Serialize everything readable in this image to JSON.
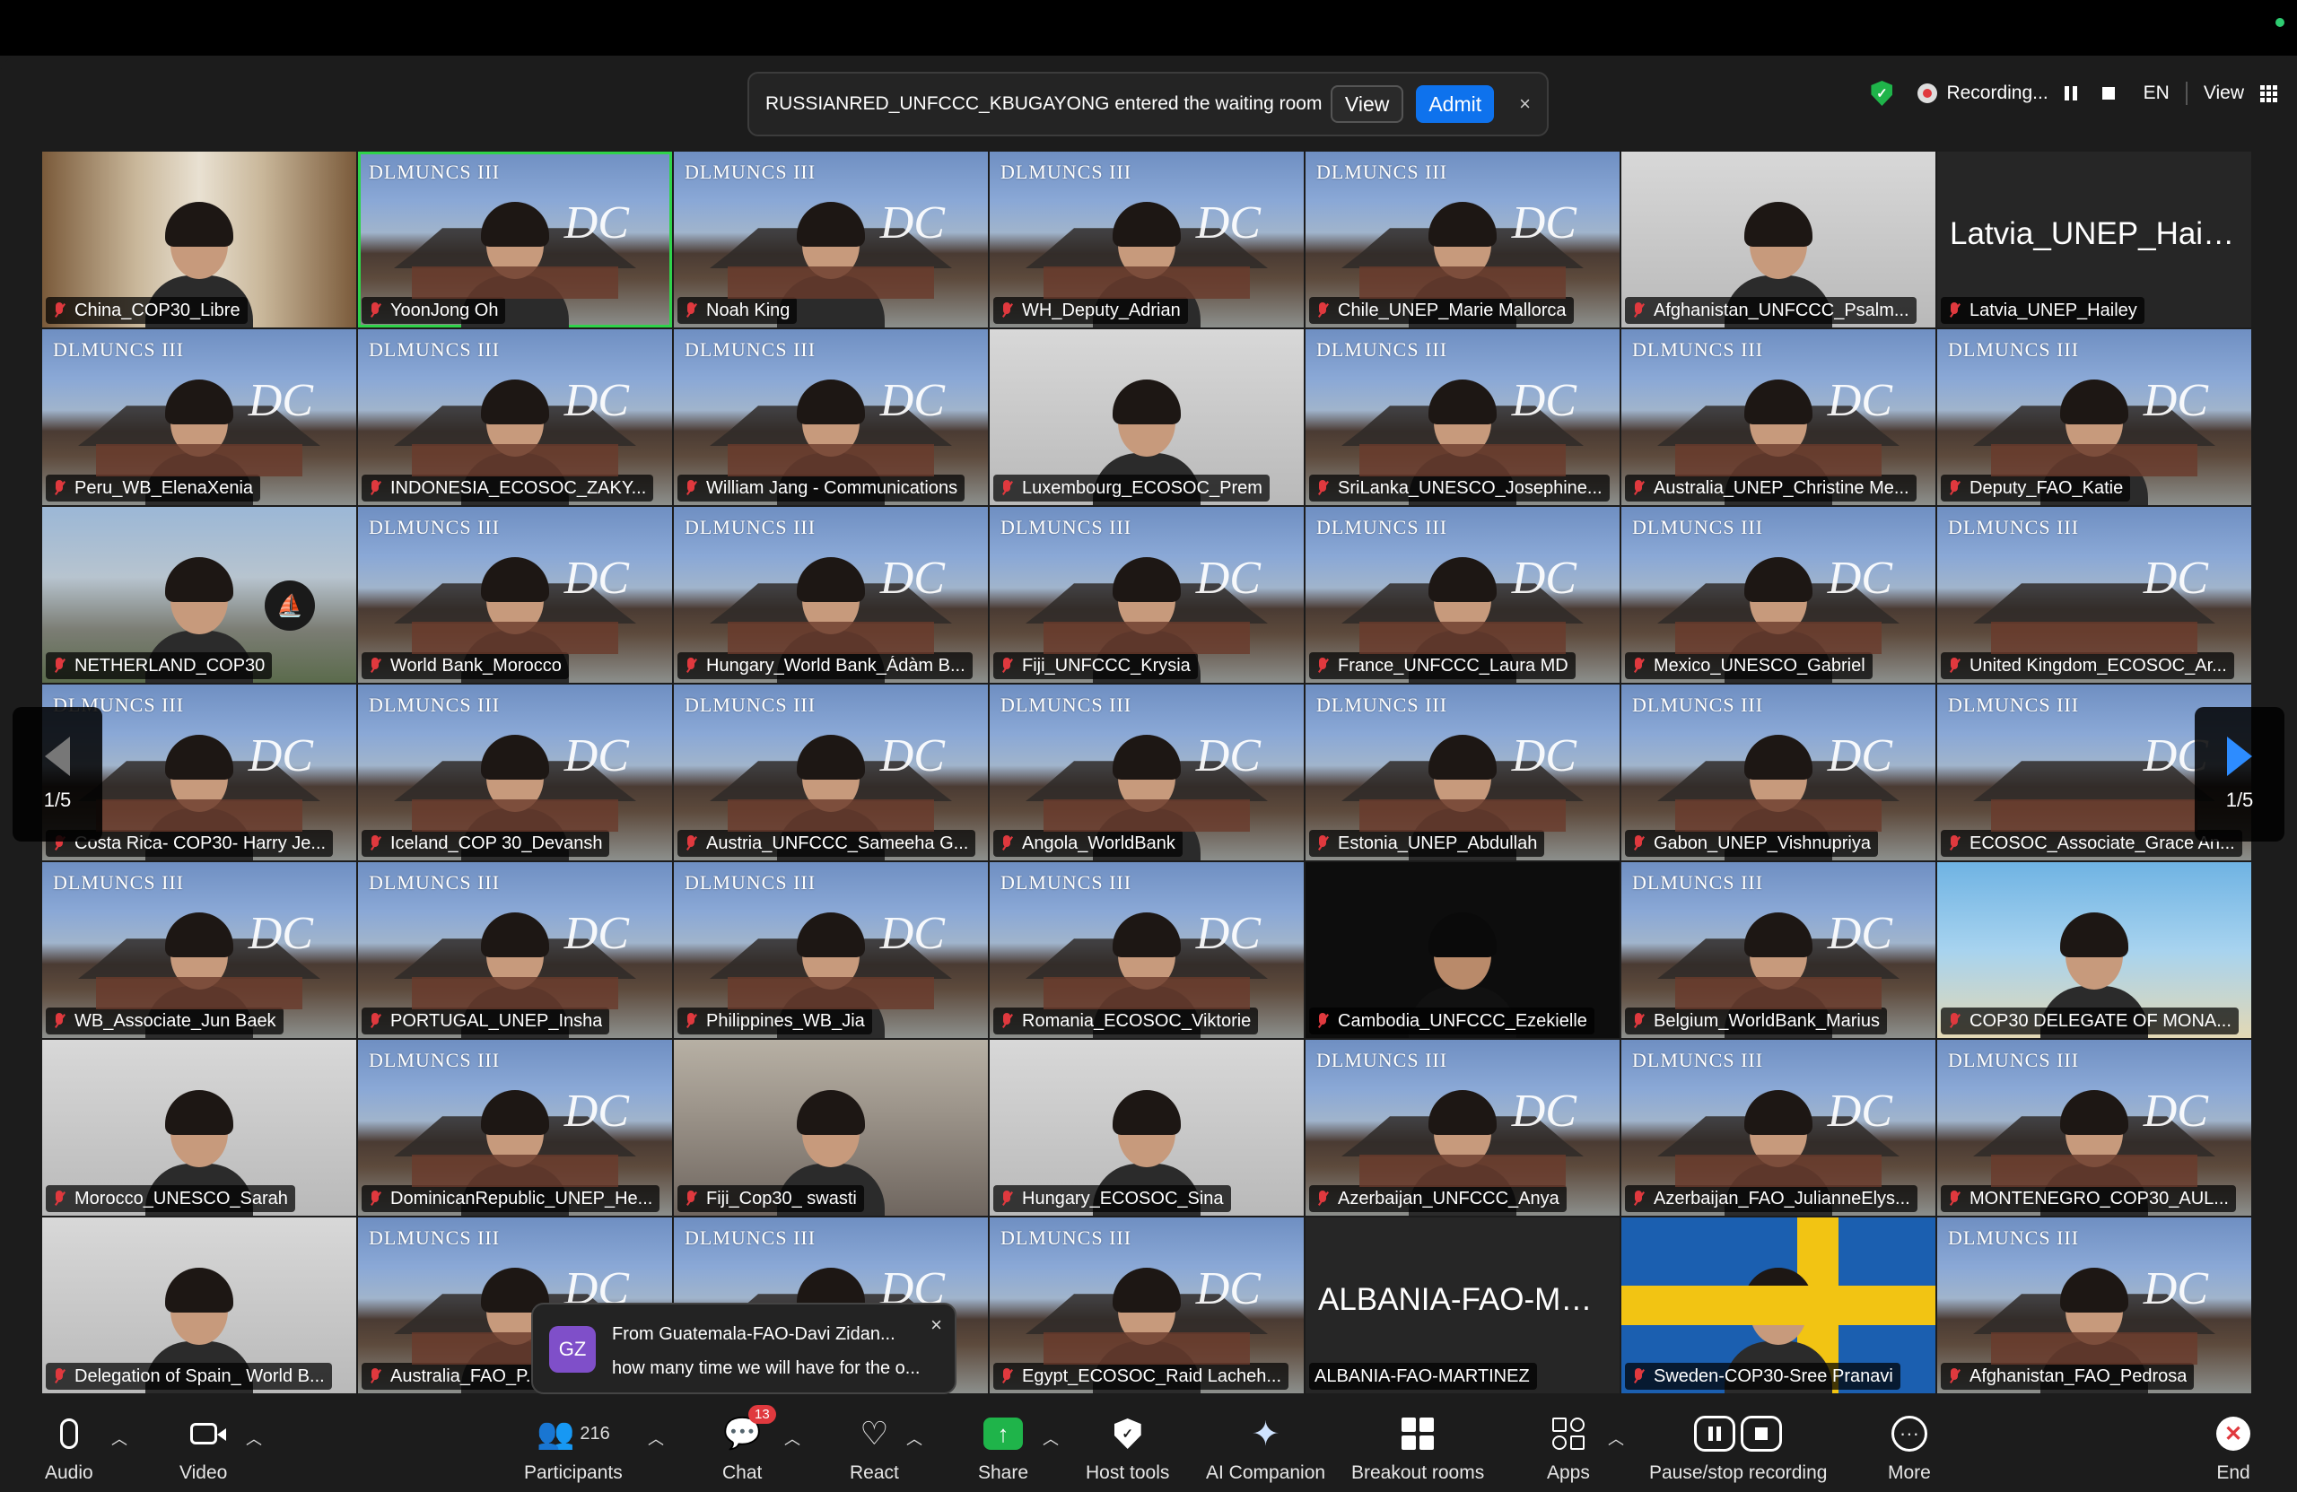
{
  "notification": {
    "message": "RUSSIANRED_UNFCCC_KBUGAYONG entered the waiting room",
    "view_label": "View",
    "admit_label": "Admit",
    "close_glyph": "×"
  },
  "status": {
    "recording_label": "Recording...",
    "language": "EN",
    "view_label": "View"
  },
  "pager": {
    "left": "1/5",
    "right": "1/5"
  },
  "tile_brand": "DLMUNCS III",
  "tiles": [
    {
      "name": "China_COP30_Libre",
      "bg": "shelf"
    },
    {
      "name": "YoonJong Oh",
      "bg": "dl",
      "speaking": true
    },
    {
      "name": "Noah King",
      "bg": "dl"
    },
    {
      "name": "WH_Deputy_Adrian",
      "bg": "dl"
    },
    {
      "name": "Chile_UNEP_Marie Mallorca",
      "bg": "dl"
    },
    {
      "name": "Afghanistan_UNFCCC_Psalm...",
      "bg": "white"
    },
    {
      "name": "Latvia_UNEP_Hailey",
      "bg": "plain",
      "big": "Latvia_UNEP_Hailey"
    },
    {
      "name": "Peru_WB_ElenaXenia",
      "bg": "dl"
    },
    {
      "name": "INDONESIA_ECOSOC_ZAKY...",
      "bg": "dl"
    },
    {
      "name": "William Jang - Communications",
      "bg": "dl"
    },
    {
      "name": "Luxembourg_ECOSOC_Prem",
      "bg": "white"
    },
    {
      "name": "SriLanka_UNESCO_Josephine...",
      "bg": "dl"
    },
    {
      "name": "Australia_UNEP_Christine Me...",
      "bg": "dl"
    },
    {
      "name": "Deputy_FAO_Katie",
      "bg": "dl"
    },
    {
      "name": "NETHERLAND_COP30",
      "bg": "city"
    },
    {
      "name": "World Bank_Morocco",
      "bg": "dl"
    },
    {
      "name": "Hungary_World Bank_Ádàm B...",
      "bg": "dl"
    },
    {
      "name": "Fiji_UNFCCC_Krysia",
      "bg": "dl"
    },
    {
      "name": "France_UNFCCC_Laura MD",
      "bg": "dl"
    },
    {
      "name": "Mexico_UNESCO_Gabriel",
      "bg": "dl"
    },
    {
      "name": "United Kingdom_ECOSOC_Ar...",
      "bg": "dl",
      "noperson": true
    },
    {
      "name": "Costa Rica- COP30- Harry Je...",
      "bg": "dl"
    },
    {
      "name": "Iceland_COP 30_Devansh",
      "bg": "dl"
    },
    {
      "name": "Austria_UNFCCC_Sameeha G...",
      "bg": "dl"
    },
    {
      "name": "Angola_WorldBank",
      "bg": "dl"
    },
    {
      "name": "Estonia_UNEP_Abdullah",
      "bg": "dl"
    },
    {
      "name": "Gabon_UNEP_Vishnupriya",
      "bg": "dl"
    },
    {
      "name": "ECOSOC_Associate_Grace An...",
      "bg": "dl",
      "noperson": true
    },
    {
      "name": "WB_Associate_Jun Baek",
      "bg": "dl"
    },
    {
      "name": "PORTUGAL_UNEP_Insha",
      "bg": "dl"
    },
    {
      "name": "Philippines_WB_Jia",
      "bg": "dl"
    },
    {
      "name": "Romania_ECOSOC_Viktorie",
      "bg": "dl"
    },
    {
      "name": "Cambodia_UNFCCC_Ezekielle",
      "bg": "dark"
    },
    {
      "name": "Belgium_WorldBank_Marius",
      "bg": "dl"
    },
    {
      "name": "COP30 DELEGATE OF MONA...",
      "bg": "beach"
    },
    {
      "name": "Morocco_UNESCO_Sarah",
      "bg": "white"
    },
    {
      "name": "DominicanRepublic_UNEP_He...",
      "bg": "dl"
    },
    {
      "name": "Fiji_Cop30_ swasti",
      "bg": "room"
    },
    {
      "name": "Hungary_ECOSOC_Sina",
      "bg": "white"
    },
    {
      "name": "Azerbaijan_UNFCCC_Anya",
      "bg": "dl"
    },
    {
      "name": "Azerbaijan_FAO_JulianneElys...",
      "bg": "dl"
    },
    {
      "name": "MONTENEGRO_COP30_AUL...",
      "bg": "dl"
    },
    {
      "name": "Delegation of Spain_ World B...",
      "bg": "white"
    },
    {
      "name": "Australia_FAO_P...",
      "bg": "dl"
    },
    {
      "name": "",
      "bg": "dl"
    },
    {
      "name": "Egypt_ECOSOC_Raid Lacheh...",
      "bg": "dl"
    },
    {
      "name": "ALBANIA-FAO-MARTINEZ",
      "bg": "plain",
      "big": "ALBANIA-FAO-MA...",
      "nomic": true
    },
    {
      "name": "Sweden-COP30-Sree Pranavi",
      "bg": "sweden"
    },
    {
      "name": "Afghanistan_FAO_Pedrosa",
      "bg": "dl"
    }
  ],
  "toast": {
    "initials": "GZ",
    "from": "From Guatemala-FAO-Davi Zidan...",
    "text": "how many time we will have for the o...",
    "close_glyph": "×"
  },
  "toolbar": {
    "audio": "Audio",
    "video": "Video",
    "participants": "Participants",
    "participant_count": "216",
    "chat": "Chat",
    "chat_badge": "13",
    "react": "React",
    "share": "Share",
    "host_tools": "Host tools",
    "ai_companion": "AI Companion",
    "breakout_rooms": "Breakout rooms",
    "apps": "Apps",
    "pause_stop_recording": "Pause/stop recording",
    "more": "More",
    "end": "End"
  },
  "colors": {
    "accent": "#0e72ed",
    "speaking": "#2fd34a",
    "muted": "#e0393e",
    "share": "#1fb44a"
  }
}
